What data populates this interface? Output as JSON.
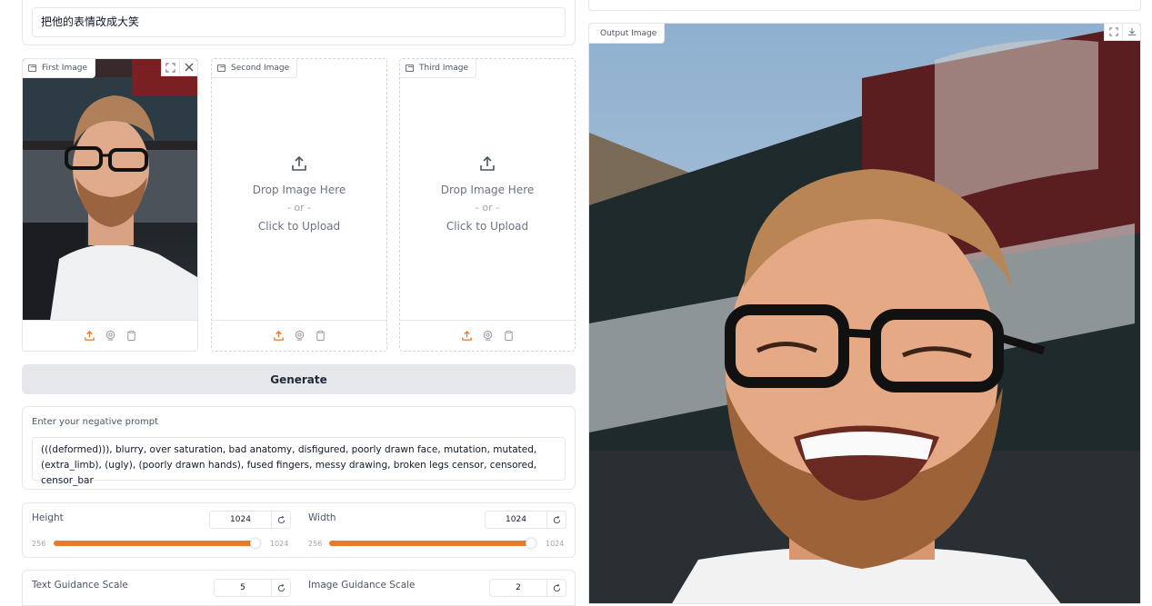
{
  "prompt": {
    "value": "把他的表情改成大笑"
  },
  "panels": {
    "first": {
      "label": "First Image"
    },
    "second": {
      "label": "Second Image",
      "drop": "Drop Image Here",
      "or": "- or -",
      "click": "Click to Upload"
    },
    "third": {
      "label": "Third Image",
      "drop": "Drop Image Here",
      "or": "- or -",
      "click": "Click to Upload"
    }
  },
  "generate": {
    "label": "Generate"
  },
  "negative": {
    "label": "Enter your negative prompt",
    "value": "(((deformed))), blurry, over saturation, bad anatomy, disfigured, poorly drawn face, mutation, mutated, (extra_limb), (ugly), (poorly drawn hands), fused fingers, messy drawing, broken legs censor, censored, censor_bar"
  },
  "height": {
    "label": "Height",
    "value": "1024",
    "min": "256",
    "max": "1024",
    "fraction": 1.0
  },
  "width": {
    "label": "Width",
    "value": "1024",
    "min": "256",
    "max": "1024",
    "fraction": 1.0
  },
  "text_guidance": {
    "label": "Text Guidance Scale",
    "value": "5"
  },
  "image_guidance": {
    "label": "Image Guidance Scale",
    "value": "2"
  },
  "output": {
    "label": "Output Image"
  },
  "colors": {
    "accent": "#ea7a2a",
    "button_bg": "#e5e7eb",
    "border": "#e5e7eb"
  },
  "icons": {
    "upload": "upload-icon",
    "webcam": "webcam-icon",
    "clipboard": "clipboard-icon",
    "fullscreen": "fullscreen-icon",
    "close": "close-icon",
    "download": "download-icon",
    "reset": "reset-icon",
    "image": "image-icon"
  }
}
